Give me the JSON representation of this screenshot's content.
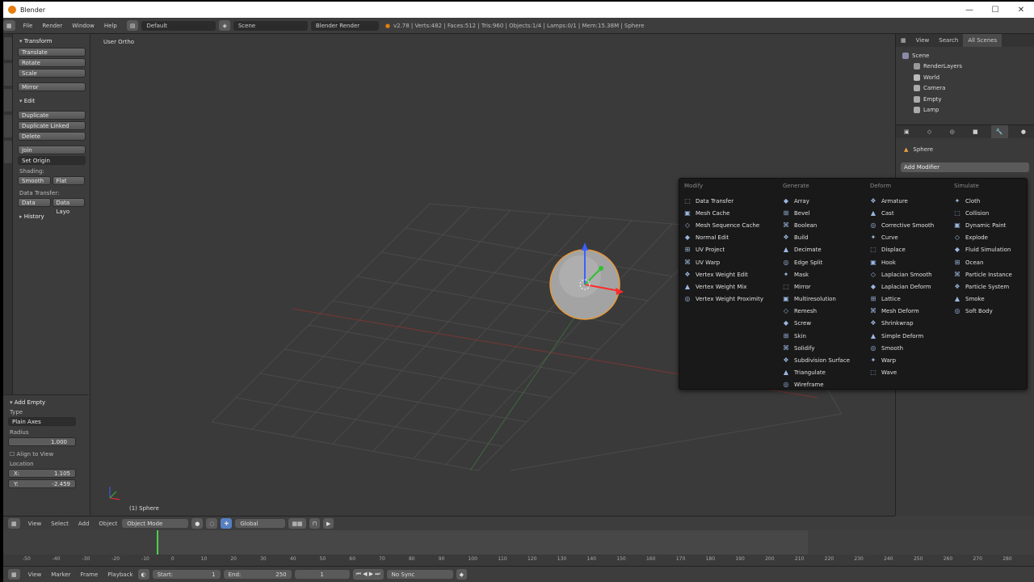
{
  "window": {
    "title": "Blender",
    "minimize": "—",
    "maximize": "☐",
    "close": "✕"
  },
  "info_header": {
    "menus": [
      "File",
      "Render",
      "Window",
      "Help"
    ],
    "screen_layout": "Default",
    "scene": "Scene",
    "render_engine": "Blender Render",
    "stats": "v2.78 | Verts:482 | Faces:512 | Tris:960 | Objects:1/4 | Lamps:0/1 | Mem:15.38M | Sphere"
  },
  "tool_shelf": {
    "transform": {
      "title": "Transform",
      "buttons": [
        "Translate",
        "Rotate",
        "Scale",
        "Mirror"
      ]
    },
    "edit": {
      "title": "Edit",
      "buttons": [
        "Duplicate",
        "Duplicate Linked",
        "Delete",
        "Join"
      ],
      "set_origin": "Set Origin"
    },
    "shading": {
      "title": "Shading:",
      "smooth": "Smooth",
      "flat": "Flat"
    },
    "data_transfer": {
      "title": "Data Transfer:",
      "data": "Data",
      "data_layout": "Data Layo"
    },
    "history": {
      "title": "History"
    }
  },
  "operator_panel": {
    "title": "Add Empty",
    "type_label": "Type",
    "type_value": "Plain Axes",
    "radius_label": "Radius",
    "radius_value": "1.000",
    "align_to_view": "Align to View",
    "location_label": "Location",
    "loc_x_label": "X:",
    "loc_x": "1.105",
    "loc_y_label": "Y:",
    "loc_y": "-2.459"
  },
  "viewport": {
    "view_label": "User Ortho",
    "object_label": "(1) Sphere"
  },
  "modifier_menu": {
    "columns": [
      {
        "heading": "Modify",
        "items": [
          "Data Transfer",
          "Mesh Cache",
          "Mesh Sequence Cache",
          "Normal Edit",
          "UV Project",
          "UV Warp",
          "Vertex Weight Edit",
          "Vertex Weight Mix",
          "Vertex Weight Proximity"
        ]
      },
      {
        "heading": "Generate",
        "items": [
          "Array",
          "Bevel",
          "Boolean",
          "Build",
          "Decimate",
          "Edge Split",
          "Mask",
          "Mirror",
          "Multiresolution",
          "Remesh",
          "Screw",
          "Skin",
          "Solidify",
          "Subdivision Surface",
          "Triangulate",
          "Wireframe"
        ]
      },
      {
        "heading": "Deform",
        "items": [
          "Armature",
          "Cast",
          "Corrective Smooth",
          "Curve",
          "Displace",
          "Hook",
          "Laplacian Smooth",
          "Laplacian Deform",
          "Lattice",
          "Mesh Deform",
          "Shrinkwrap",
          "Simple Deform",
          "Smooth",
          "Warp",
          "Wave"
        ]
      },
      {
        "heading": "Simulate",
        "items": [
          "Cloth",
          "Collision",
          "Dynamic Paint",
          "Explode",
          "Fluid Simulation",
          "Ocean",
          "Particle Instance",
          "Particle System",
          "Smoke",
          "Soft Body"
        ]
      }
    ]
  },
  "outliner": {
    "tabs": [
      "View",
      "Search",
      "All Scenes"
    ],
    "items": [
      "Scene",
      "RenderLayers",
      "World",
      "Camera",
      "Empty",
      "Lamp"
    ]
  },
  "properties": {
    "object_name": "Sphere",
    "add_modifier": "Add Modifier"
  },
  "viewport_header": {
    "menus": [
      "View",
      "Select",
      "Add",
      "Object"
    ],
    "mode": "Object Mode",
    "orientation": "Global"
  },
  "timeline": {
    "ticks": [
      "-50",
      "-40",
      "-30",
      "-20",
      "-10",
      "0",
      "10",
      "20",
      "30",
      "40",
      "50",
      "60",
      "70",
      "80",
      "90",
      "100",
      "110",
      "120",
      "130",
      "140",
      "150",
      "160",
      "170",
      "180",
      "190",
      "200",
      "210",
      "220",
      "230",
      "240",
      "250",
      "260",
      "270",
      "280"
    ],
    "menus": [
      "View",
      "Marker",
      "Frame",
      "Playback"
    ],
    "start_label": "Start:",
    "start": "1",
    "end_label": "End:",
    "end": "250",
    "current": "1",
    "sync": "No Sync"
  }
}
